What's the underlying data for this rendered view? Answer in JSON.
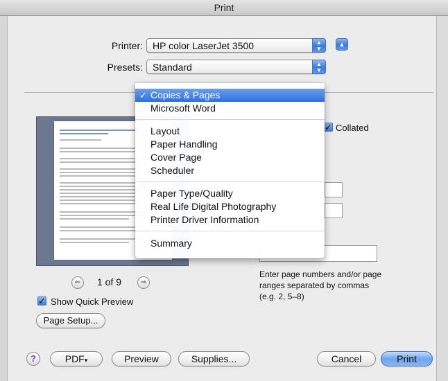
{
  "window": {
    "title": "Print"
  },
  "printer": {
    "label": "Printer:",
    "value": "HP color LaserJet 3500"
  },
  "presets": {
    "label": "Presets:",
    "value": "Standard"
  },
  "menu": {
    "items": [
      "Copies & Pages",
      "Microsoft Word",
      "Layout",
      "Paper Handling",
      "Cover Page",
      "Scheduler",
      "Paper Type/Quality",
      "Real Life Digital Photography",
      "Printer Driver Information",
      "Summary"
    ],
    "selected": "Copies & Pages",
    "check_glyph": "✓"
  },
  "copies": {
    "collated_label": "Collated",
    "collated_checked": true
  },
  "preview": {
    "page_indicator": "1 of 9",
    "show_quick_preview_label": "Show Quick Preview",
    "show_quick_preview_checked": true
  },
  "page_range_hint": "Enter page numbers and/or page ranges separated by commas (e.g. 2, 5–8)",
  "buttons": {
    "page_setup": "Page Setup...",
    "help": "?",
    "pdf": "PDF",
    "pdf_arrow": "▾",
    "preview": "Preview",
    "supplies": "Supplies...",
    "cancel": "Cancel",
    "print": "Print"
  },
  "colors": {
    "accent": "#3d7cd6",
    "menu_highlight": "#2d6fdc",
    "preview_bg": "#6b7890"
  }
}
